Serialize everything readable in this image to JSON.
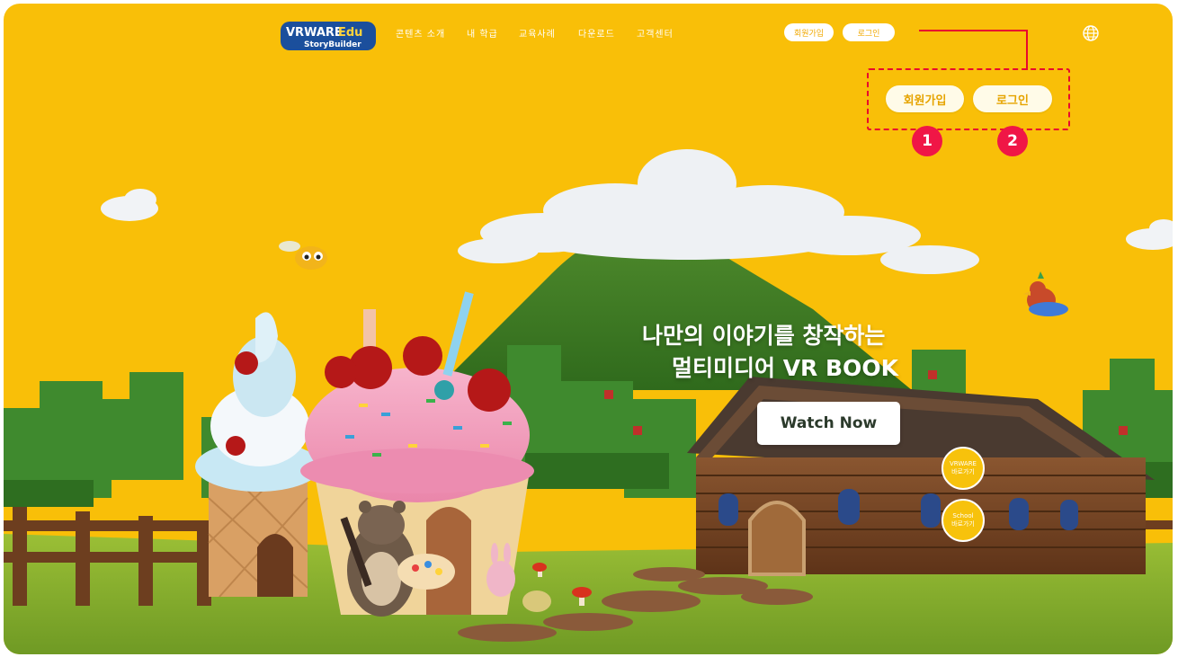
{
  "brand": {
    "logo_main": "VRWARE",
    "logo_accent": "Edu",
    "logo_sub": "StoryBuilder"
  },
  "nav": {
    "items": [
      {
        "label": "콘텐츠 소개"
      },
      {
        "label": "내 학급"
      },
      {
        "label": "교육사례"
      },
      {
        "label": "다운로드"
      },
      {
        "label": "고객센터"
      }
    ],
    "signup_label": "회원가입",
    "login_label": "로그인"
  },
  "callout": {
    "signup_label": "회원가입",
    "login_label": "로그인",
    "badge_1": "1",
    "badge_2": "2",
    "color": "#e8082e"
  },
  "hero": {
    "line1": "나만의 이야기를 창작하는",
    "line2": "멀티미디어 VR BOOK",
    "cta_label": "Watch Now"
  },
  "shortcuts": [
    {
      "title": "VRWARE",
      "sub": "바로가기"
    },
    {
      "title": "School",
      "sub": "바로가기"
    }
  ],
  "colors": {
    "background": "#f9bf08",
    "badge": "#f01646",
    "accent_text": "#e6a400"
  }
}
